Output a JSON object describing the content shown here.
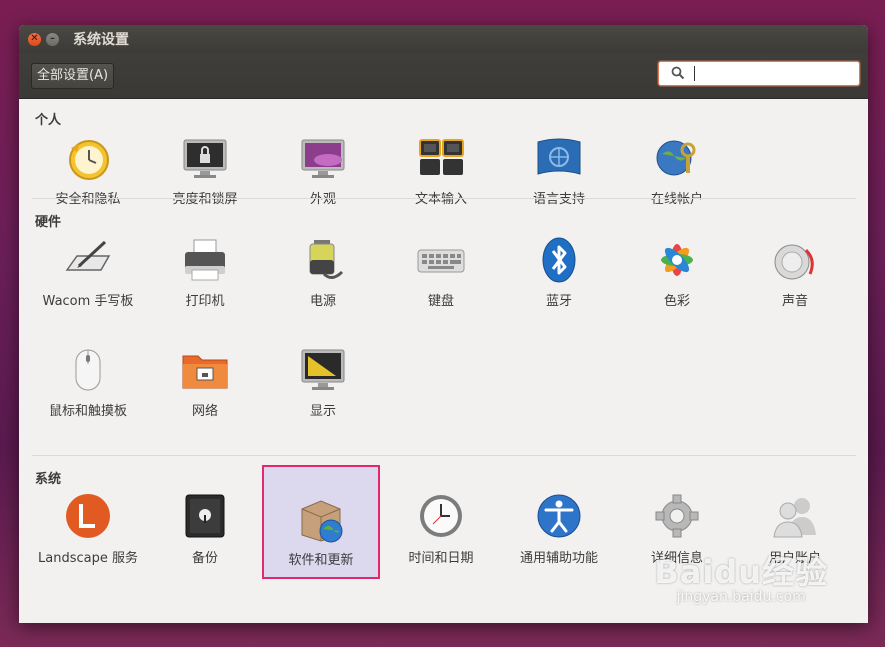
{
  "window": {
    "title": "系统设置"
  },
  "toolbar": {
    "all_settings_label": "全部设置(A)",
    "search_value": ""
  },
  "sections": {
    "personal": {
      "title": "个人",
      "items": [
        "安全和隐私",
        "亮度和锁屏",
        "外观",
        "文本输入",
        "语言支持",
        "在线帐户"
      ]
    },
    "hardware": {
      "title": "硬件",
      "items": [
        "Wacom 手写板",
        "打印机",
        "电源",
        "键盘",
        "蓝牙",
        "色彩",
        "声音",
        "鼠标和触摸板",
        "网络",
        "显示"
      ]
    },
    "system": {
      "title": "系统",
      "items": [
        "Landscape 服务",
        "备份",
        "软件和更新",
        "时间和日期",
        "通用辅助功能",
        "详细信息",
        "用户账户"
      ]
    }
  },
  "selected_item": "软件和更新",
  "watermark": {
    "brand": "Baidu经验",
    "url": "jingyan.baidu.com"
  },
  "colors": {
    "accent": "#e07b4f",
    "selection_border": "#e4286f",
    "selection_bg": "#dcd8ee",
    "titlebar": "#3c3b37"
  }
}
